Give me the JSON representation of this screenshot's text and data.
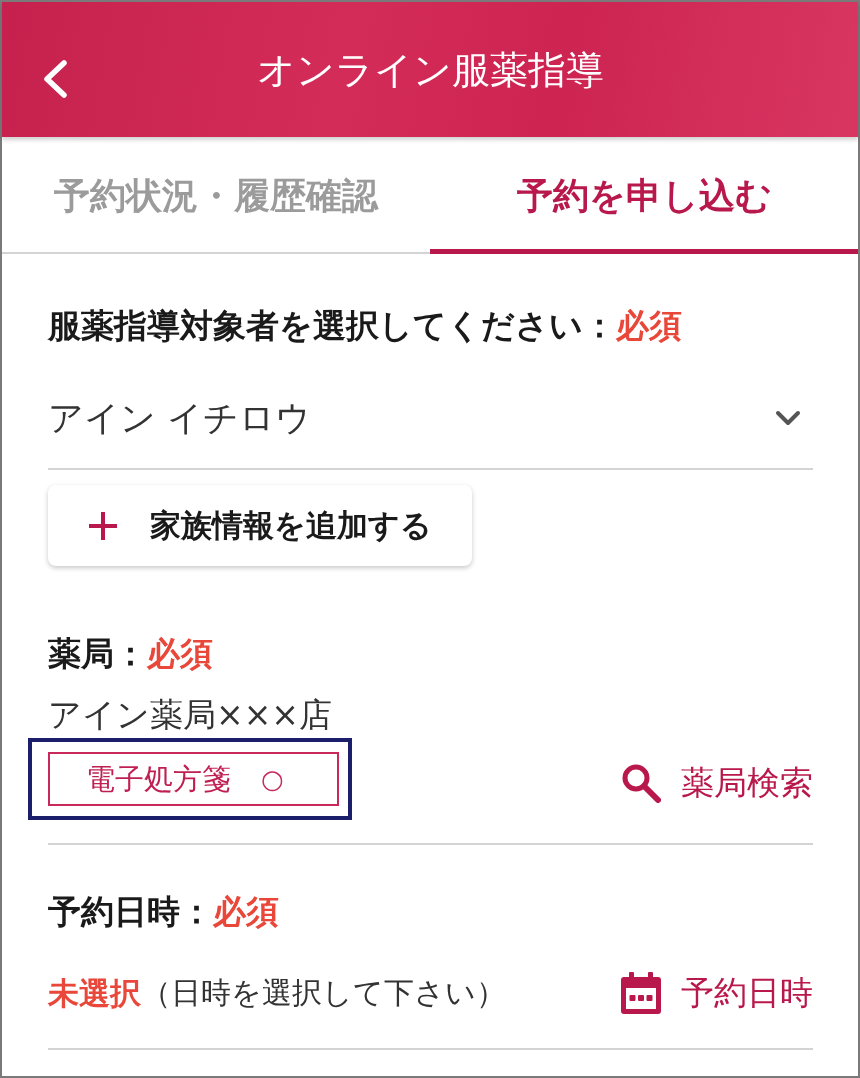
{
  "header": {
    "title": "オンライン服薬指導"
  },
  "tabs": [
    {
      "label": "予約状況・履歴確認",
      "selected": false
    },
    {
      "label": "予約を申し込む",
      "selected": true
    }
  ],
  "patient": {
    "label": "服薬指導対象者を選択してください：",
    "required": "必須",
    "value": "アイン イチロウ",
    "add_button": "家族情報を追加する"
  },
  "pharmacy": {
    "label": "薬局：",
    "required": "必須",
    "name": "アイン薬局×××店",
    "tag": {
      "label": "電子処方箋",
      "mark": "○",
      "highlighted": true
    },
    "search_button": "薬局検索"
  },
  "appointment": {
    "label": "予約日時：",
    "required": "必須",
    "status": "未選択",
    "hint": "（日時を選択して下さい）",
    "button": "予約日時"
  }
}
